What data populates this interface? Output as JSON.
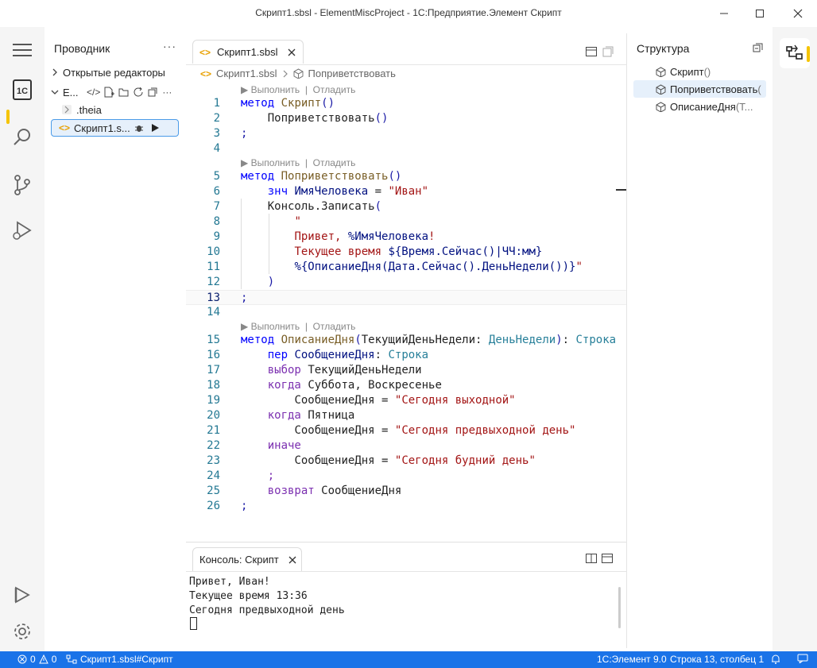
{
  "window": {
    "title": "Скрипт1.sbsl - ElementMiscProject - 1С:Предприятие.Элемент Скрипт"
  },
  "explorer": {
    "title": "Проводник",
    "more": "···",
    "open_editors": "Открытые редакторы",
    "project": "E...",
    "folder": ".theia",
    "file": "Скрипт1.s..."
  },
  "editor": {
    "tab_label": "Скрипт1.sbsl",
    "breadcrumb_file": "Скрипт1.sbsl",
    "breadcrumb_symbol": "Поприветствовать",
    "codelens_run": "Выполнить",
    "codelens_sep": "|",
    "codelens_debug": "Отладить",
    "line_numbers": [
      "1",
      "2",
      "3",
      "4",
      "5",
      "6",
      "7",
      "8",
      "9",
      "10",
      "11",
      "12",
      "13",
      "14",
      "15",
      "16",
      "17",
      "18",
      "19",
      "20",
      "21",
      "22",
      "23",
      "24",
      "25",
      "26"
    ]
  },
  "console": {
    "tab_label": "Консоль: Скрипт",
    "lines": [
      "Привет, Иван!",
      "Текущее время 13:36",
      "Сегодня предвыходной день"
    ]
  },
  "structure": {
    "title": "Структура",
    "items": [
      {
        "label": "Скрипт",
        "suffix": "()"
      },
      {
        "label": "Поприветствовать",
        "suffix": "("
      },
      {
        "label": "ОписаниеДня",
        "suffix": "(Т..."
      }
    ]
  },
  "statusbar": {
    "errors": "0",
    "warnings": "0",
    "context": "Скрипт1.sbsl#Скрипт",
    "version": "1С:Элемент 9.0",
    "position": "Строка 13, столбец 1"
  },
  "colors": {
    "accent": "#1a73e8",
    "marker": "#f5c400",
    "selection": "#e6f0fb"
  }
}
